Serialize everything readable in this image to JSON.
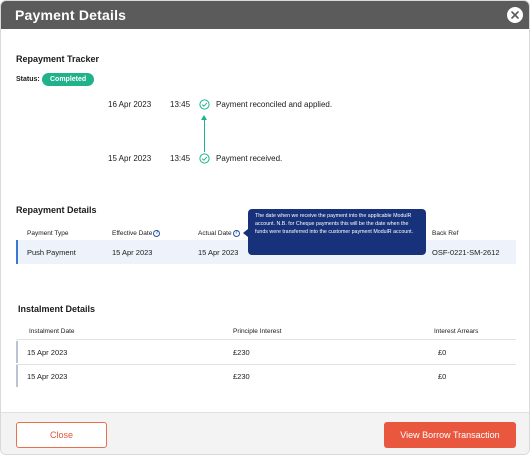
{
  "modal": {
    "title": "Payment Details"
  },
  "tracker": {
    "heading": "Repayment Tracker",
    "status_label": "Status:",
    "status_value": "Completed",
    "events": [
      {
        "date": "16 Apr 2023",
        "time": "13:45",
        "text": "Payment reconciled and applied."
      },
      {
        "date": "15 Apr 2023",
        "time": "13:45",
        "text": "Payment received."
      }
    ]
  },
  "repayment": {
    "heading": "Repayment Details",
    "columns": [
      "Payment Type",
      "Effective Date",
      "Actual Date",
      "Back Ref"
    ],
    "row": {
      "payment_type": "Push Payment",
      "effective_date": "15 Apr 2023",
      "actual_date": "15 Apr 2023",
      "back_ref": "OSF-0221-SM-2612"
    },
    "tooltip": "The date when we receive the payment into the applicable ModulR account. N.B. for Cheque payments this will be the date when the funds were transferred into the customer payment ModulR account."
  },
  "instalments": {
    "heading": "Instalment Details",
    "columns": [
      "Instalment Date",
      "Principle Interest",
      "Interest Arrears"
    ],
    "rows": [
      {
        "date": "15 Apr 2023",
        "principle": "£230",
        "arrears": "£0"
      },
      {
        "date": "15 Apr 2023",
        "principle": "£230",
        "arrears": "£0"
      }
    ]
  },
  "footer": {
    "close_label": "Close",
    "view_label": "View Borrow Transaction"
  },
  "colors": {
    "accent_green": "#1fb28b",
    "tooltip_navy": "#17327a",
    "button_orange": "#e9573f",
    "titlebar_gray": "#5b5b5b"
  },
  "icons": {
    "close": "close-icon",
    "check": "check-circle-icon",
    "help": "help-circle-icon",
    "arrow": "arrow-up-icon"
  }
}
